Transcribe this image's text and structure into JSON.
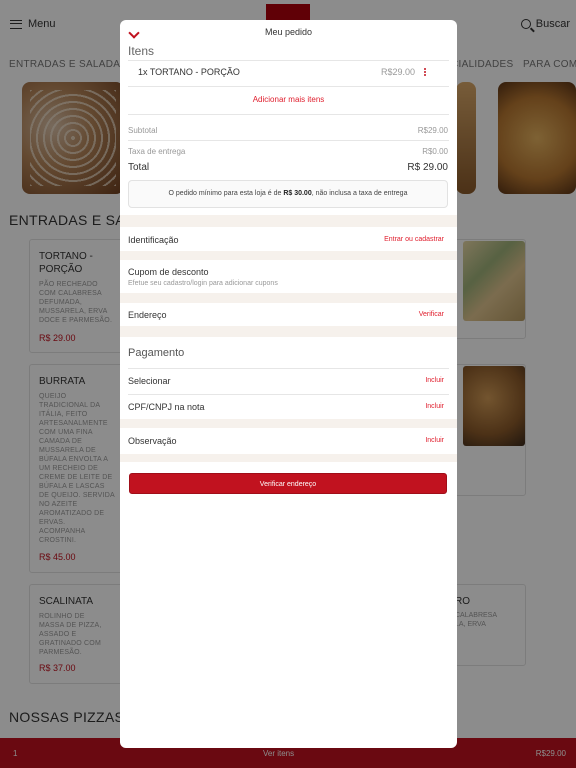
{
  "header": {
    "menu_label": "Menu",
    "search_label": "Buscar"
  },
  "categories": [
    "ENTRADAS E SALADAS",
    "CIALIDADES",
    "PARA COMP"
  ],
  "sections": {
    "entradas": "ENTRADAS E SAL",
    "pizzas": "NOSSAS PIZZAS"
  },
  "products": [
    {
      "name": "TORTANO -\nPORÇÃO",
      "description": "PÃO RECHEADO\nCOM CALABRESA\nDEFUMADA,\nMUSSARELA, ERVA\nDOCE E PARMESÃO.",
      "price": "R$ 29.00"
    },
    {
      "name": "BURRATA",
      "description": "QUEIJO\nTRADICIONAL DA\nITÁLIA, FEITO\nARTESANALMENTE\nCOM UMA FINA\nCAMADA DE\nMUSSARELA DE\nBÚFALA ENVOLTA A\nUM RECHEIO DE\nCREME DE LEITE DE\nBÚFALA E LASCAS\nDE QUEIJO. SERVIDA\nNO AZEITE\nAROMATIZADO DE\nERVAS.\nACOMPANHA\nCROSTINI.",
      "price": "R$ 45.00"
    },
    {
      "name": "SCALINATA",
      "description": "ROLINHO DE\nMASSA DE PIZZA,\nASSADO E\nGRATINADO COM\nPARMESÃO.",
      "price": "R$ 37.00"
    }
  ],
  "partial_card": {
    "title": "RO",
    "desc": "CALABRESA\nLA, ERVA"
  },
  "cart_bar": {
    "count": "1",
    "label": "Ver itens",
    "total": "R$29.00"
  },
  "order_modal": {
    "title": "Meu pedido",
    "items_heading": "Itens",
    "items": [
      {
        "name": "1x TORTANO - PORÇÃO",
        "price": "R$29.00"
      }
    ],
    "add_more": "Adicionar mais itens",
    "subtotal_label": "Subtotal",
    "subtotal_value": "R$29.00",
    "delivery_label": "Taxa de entrega",
    "delivery_value": "R$0.00",
    "total_label": "Total",
    "total_value": "R$ 29.00",
    "notice_prefix": "O pedido mínimo para esta loja é de ",
    "notice_amount": "R$ 30.00",
    "notice_suffix": ", não inclusa a taxa de entrega",
    "identification_label": "Identificação",
    "identification_link": "Entrar ou cadastrar",
    "coupon_label": "Cupom de desconto",
    "coupon_sub": "Efetue seu cadastro/login para adicionar cupons",
    "address_label": "Endereço",
    "address_link": "Verificar",
    "payment_heading": "Pagamento",
    "select_label": "Selecionar",
    "select_link": "Incluir",
    "cpf_label": "CPF/CNPJ na nota",
    "cpf_link": "Incluir",
    "note_label": "Observação",
    "note_link": "Incluir",
    "verify_button": "Verificar endereço"
  },
  "colors": {
    "brand_red": "#c1121f",
    "link_red": "#e0202f",
    "section_gap": "#f6f1ec"
  },
  "icons": [
    "hamburger-icon",
    "search-icon",
    "chevron-down-icon",
    "kebab-menu-icon"
  ]
}
